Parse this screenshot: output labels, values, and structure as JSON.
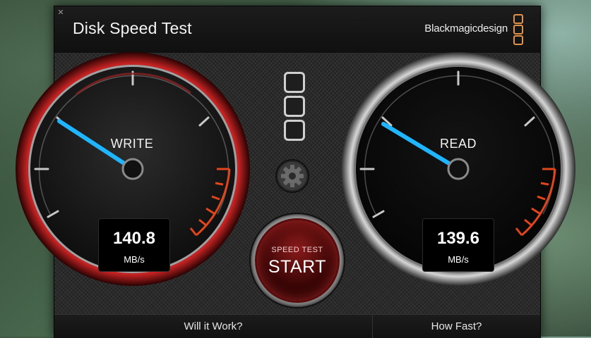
{
  "window": {
    "title": "Disk Speed Test",
    "close_icon": "close-icon"
  },
  "brand": {
    "name": "Blackmagicdesign",
    "logo_icon": "blackmagic-logo-icon",
    "accent_color": "#e2914a"
  },
  "write_gauge": {
    "label": "WRITE",
    "value": "140.8",
    "unit": "MB/s",
    "needle_color": "#1fb6ff",
    "rim_color": "#b51e1e"
  },
  "read_gauge": {
    "label": "READ",
    "value": "139.6",
    "unit": "MB/s",
    "needle_color": "#1fb6ff",
    "rim_color": "#cfcfcf"
  },
  "controls": {
    "selector_icon": "format-selector-icon",
    "settings_icon": "gear-icon",
    "start_small": "SPEED TEST",
    "start_big": "START"
  },
  "footer": {
    "left_tab": "Will it Work?",
    "right_tab": "How Fast?"
  }
}
